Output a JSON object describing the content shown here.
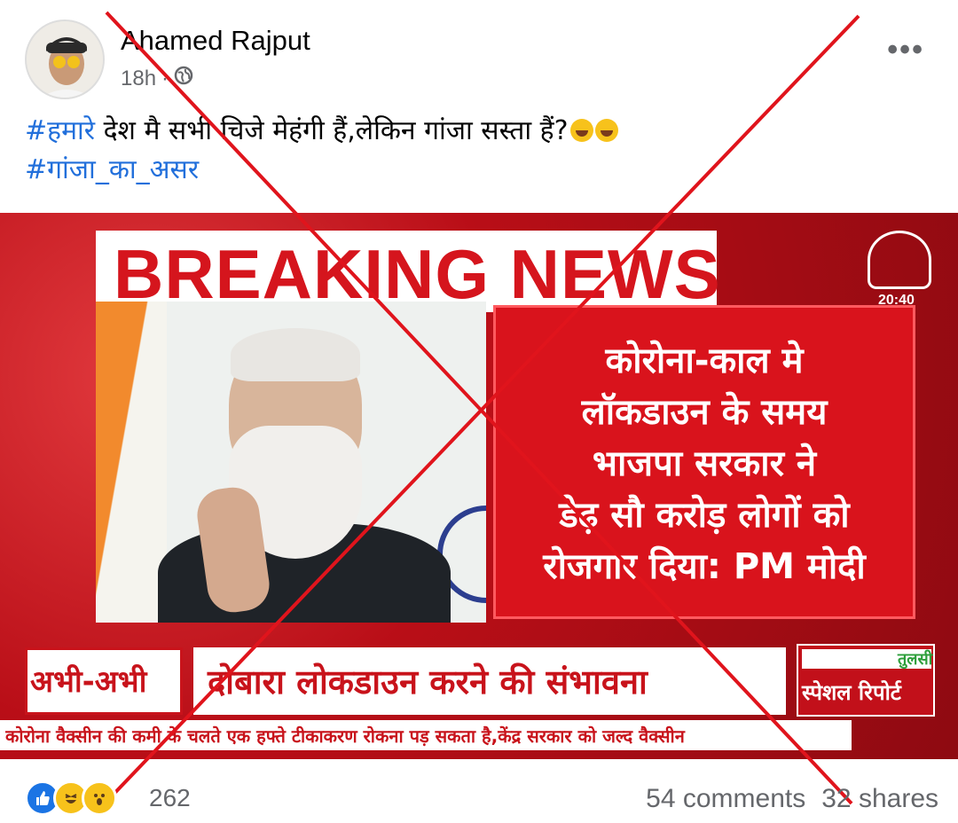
{
  "post": {
    "author": "Ahamed Rajput",
    "time": "18h",
    "privacy_icon": "globe-icon",
    "more_icon": "more-dots-icon",
    "caption_hashtag_1": "#हमारे",
    "caption_text": " देश मै सभी चिजे मेहंगी हैं,लेकिन गांजा सस्ता हैं?",
    "caption_emojis": [
      "rofl-emoji",
      "rofl-emoji"
    ],
    "caption_hashtag_2": "#गांजा_का_असर"
  },
  "media": {
    "breaking_banner": "BREAKING NEWS",
    "channel_time": "20:40",
    "headline_lines": [
      "कोरोना-काल मे",
      "लॉकडाउन के समय",
      "भाजपा सरकार ने",
      "डेढ़ सौ करोड़ लोगों को",
      "रोजगार दिया: PM मोदी"
    ],
    "ticker_label": "अभी-अभी",
    "ticker_text": "दोबारा लोकडाउन करने की संभावना",
    "special_brand": "तुलसी",
    "special_label": "स्पेशल रिपोर्ट",
    "crawl_text": "कोरोना वैक्सीन की कमी के चलते एक हफ्ते टीकाकरण रोकना पड़ सकता है,केंद्र सरकार को जल्द वैक्सीन",
    "overlay_color": "#e0141c"
  },
  "footer": {
    "reaction_icons": [
      "like-icon",
      "haha-icon",
      "wow-icon"
    ],
    "reaction_count": "262",
    "comments": "54 comments",
    "shares": "32 shares"
  },
  "colors": {
    "hashtag": "#216fdb",
    "secondary_text": "#65676b",
    "like_blue": "#1b74e4"
  }
}
